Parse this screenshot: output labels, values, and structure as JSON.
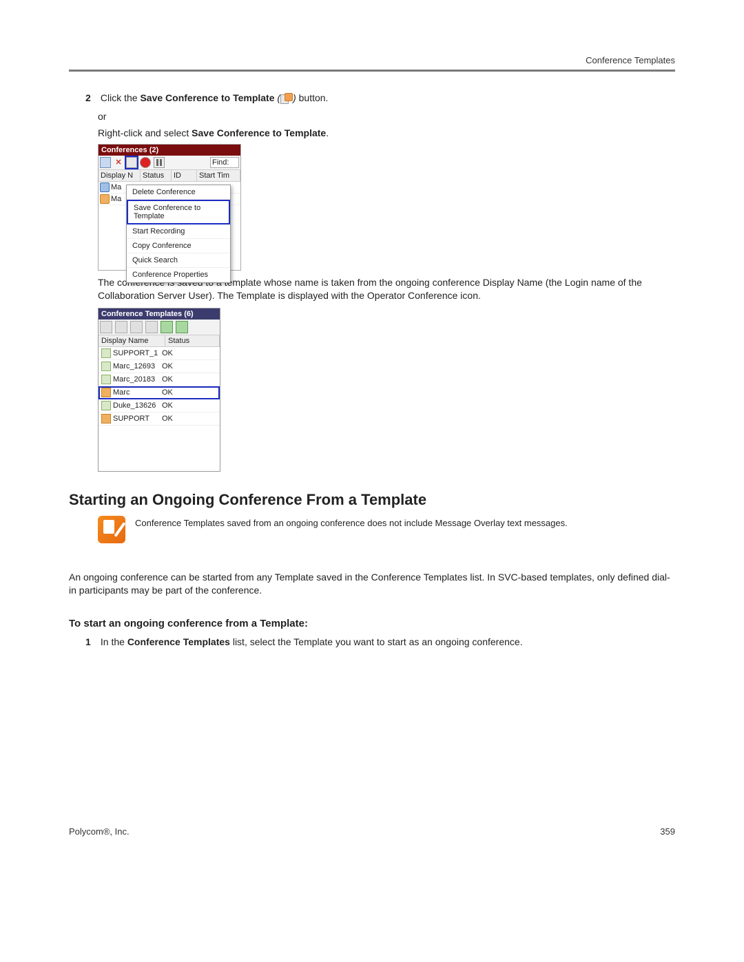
{
  "header_right": "Conference Templates",
  "step2": {
    "num": "2",
    "pre": "Click the ",
    "bold": "Save Conference to Template",
    "italic_open": " (",
    "italic_close": ") ",
    "post": "button.",
    "or": "or",
    "right_click_pre": "Right-click and select ",
    "right_click_bold": "Save Conference to Template",
    "right_click_post": "."
  },
  "conferences_panel": {
    "title": "Conferences (2)",
    "find_label": "Find:",
    "columns": {
      "name": "Display N",
      "status": "Status",
      "id": "ID",
      "start": "Start Tim"
    },
    "rows": [
      {
        "name": "Ma",
        "icon": "blue"
      },
      {
        "name": "Ma",
        "icon": "orange"
      }
    ],
    "context_menu": [
      "Delete Conference",
      "Save Conference to Template",
      "Start Recording",
      "Copy Conference",
      "Quick Search",
      "Conference Properties"
    ],
    "highlight_index": 1
  },
  "after_panel_para": "The conference is saved to a template whose name is taken from the ongoing conference Display Name (the Login name of the Collaboration Server User). The Template is displayed with the Operator Conference icon.",
  "templates_panel": {
    "title": "Conference Templates (6)",
    "columns": {
      "name": "Display Name",
      "status": "Status"
    },
    "rows": [
      {
        "name": "SUPPORT_1",
        "status": "OK",
        "icon": "tmpl"
      },
      {
        "name": "Marc_12693",
        "status": "OK",
        "icon": "tmpl"
      },
      {
        "name": "Marc_20183",
        "status": "OK",
        "icon": "tmpl"
      },
      {
        "name": "Marc",
        "status": "OK",
        "icon": "op",
        "highlight": true
      },
      {
        "name": "Duke_13626",
        "status": "OK",
        "icon": "tmpl"
      },
      {
        "name": "SUPPORT",
        "status": "OK",
        "icon": "op"
      }
    ]
  },
  "section_heading": "Starting an Ongoing Conference From a Template",
  "note_text": "Conference Templates saved from an ongoing conference does not include Message Overlay text messages.",
  "body_para": "An ongoing conference can be started from any Template saved in the Conference Templates list. In SVC-based templates, only defined dial-in participants may be part of the conference.",
  "sub_heading": "To start an ongoing conference from a Template:",
  "step1_sub": {
    "num": "1",
    "pre": "In the ",
    "bold": "Conference Templates",
    "post": " list, select the Template you want to start as an ongoing conference."
  },
  "footer_left": "Polycom®, Inc.",
  "footer_right": "359"
}
